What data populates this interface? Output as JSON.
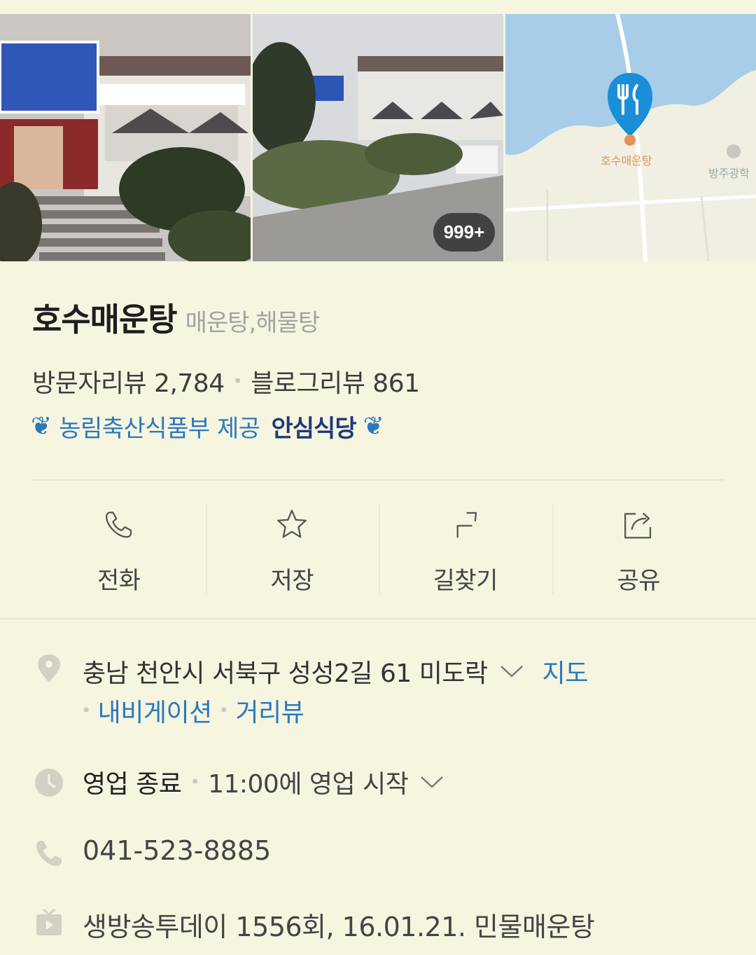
{
  "photos": {
    "count_badge": "999+",
    "map": {
      "pin_label": "호수매운탕",
      "poi_label": "방주광학"
    }
  },
  "place": {
    "name": "호수매운탕",
    "category": "매운탕,해물탕"
  },
  "reviews": {
    "visitor": "방문자리뷰 2,784",
    "blog": "블로그리뷰 861"
  },
  "certification": {
    "provider": "농림축산식품부 제공",
    "badge": "안심식당"
  },
  "actions": [
    {
      "label": "전화",
      "icon": "phone-icon"
    },
    {
      "label": "저장",
      "icon": "star-icon"
    },
    {
      "label": "길찾기",
      "icon": "directions-icon"
    },
    {
      "label": "공유",
      "icon": "share-icon"
    }
  ],
  "address": {
    "text": "충남 천안시 서북구 성성2길 61 미도락",
    "map_link": "지도",
    "navigation_link": "내비게이션",
    "street_view_link": "거리뷰"
  },
  "hours": {
    "status": "영업 종료",
    "next_open": "11:00에 영업 시작"
  },
  "phone": "041-523-8885",
  "tv": "생방송투데이 1556회, 16.01.21. 민물매운탕",
  "colors": {
    "background": "#f6f5e0",
    "link": "#2b78be",
    "pin": "#1a8fd8",
    "icon_gray": "#d4d0c4"
  }
}
